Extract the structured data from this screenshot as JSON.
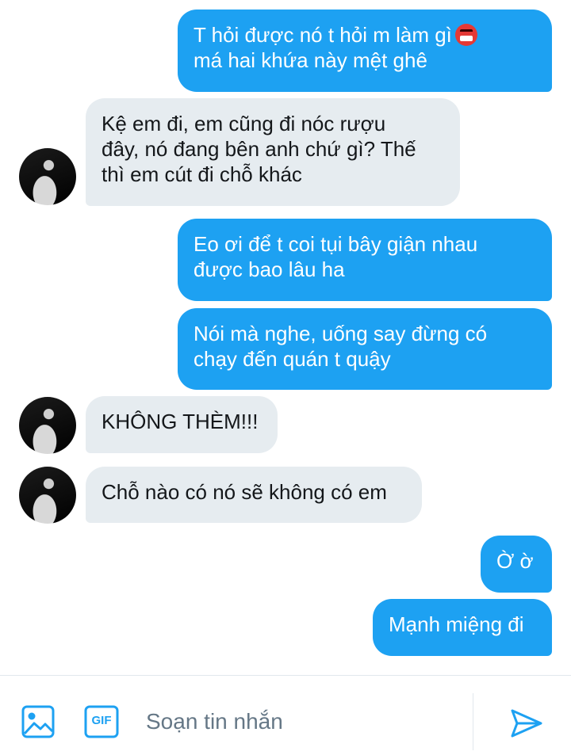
{
  "messages": [
    {
      "side": "out",
      "lines": [
        "T hỏi được nó t hỏi m làm gì",
        "má hai khứa này mệt ghê"
      ],
      "emoji": "angry-face-with-symbols-icon"
    },
    {
      "side": "in",
      "lines": [
        "Kệ em đi, em cũng đi nóc rượu",
        "đây, nó đang bên anh chứ gì? Thế",
        "thì em cút đi chỗ khác"
      ]
    },
    {
      "side": "out",
      "lines": [
        "Eo ơi để t coi tụi bây giận nhau",
        "được bao lâu ha"
      ]
    },
    {
      "side": "out",
      "lines": [
        "Nói mà nghe, uống say đừng có",
        "chạy đến quán t quậy"
      ]
    },
    {
      "side": "in",
      "lines": [
        "KHÔNG THÈM!!!"
      ]
    },
    {
      "side": "in",
      "lines": [
        "Chỗ nào có nó sẽ không có em"
      ]
    },
    {
      "side": "out",
      "lines": [
        "Ờ ờ"
      ]
    },
    {
      "side": "out",
      "lines": [
        "Mạnh miệng đi"
      ]
    }
  ],
  "composer": {
    "image_icon": "image-icon",
    "gif_icon": "gif-icon",
    "gif_label": "GIF",
    "placeholder": "Soạn tin nhắn",
    "send_icon": "send-icon"
  },
  "colors": {
    "accent": "#1da1f2",
    "incoming_bubble": "#e6ecf0",
    "placeholder": "#657786"
  }
}
